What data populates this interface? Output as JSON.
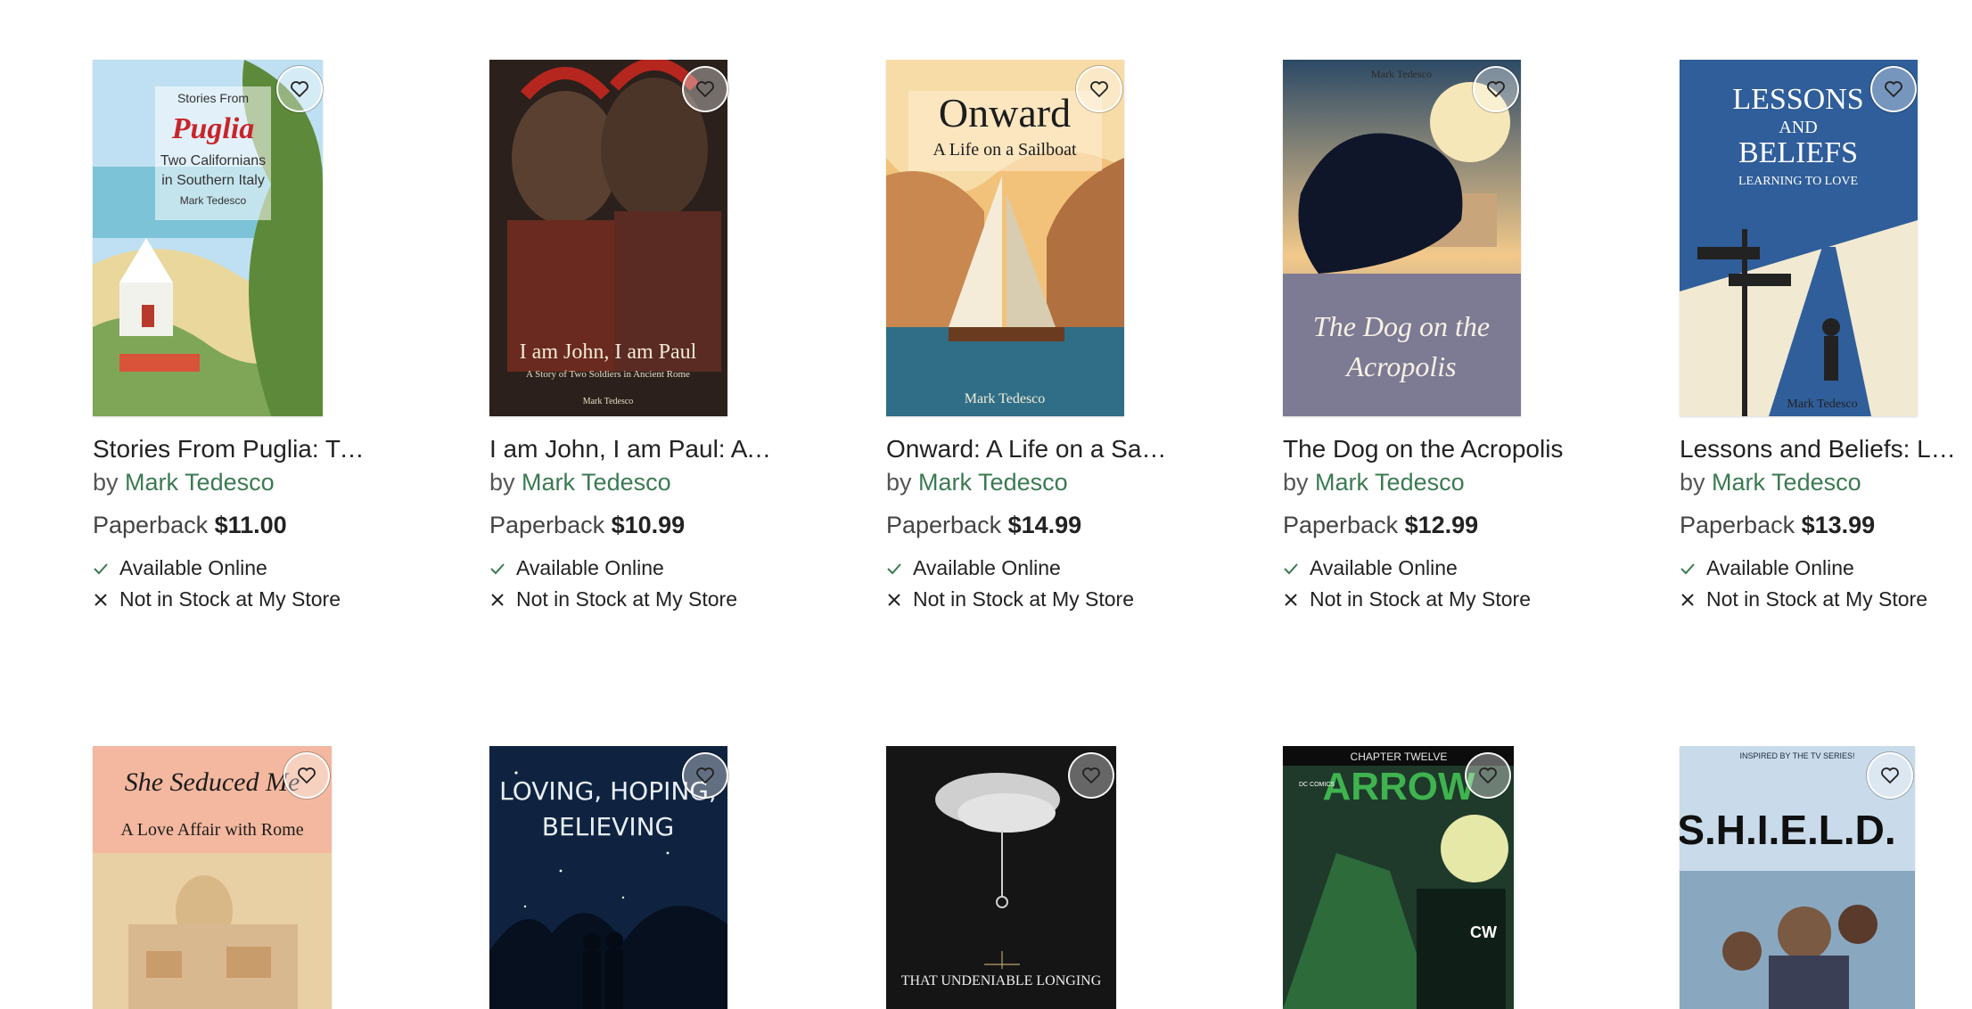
{
  "colors": {
    "author_link": "#3b7a52",
    "check": "#3b7a52",
    "x_mark": "#222222"
  },
  "books": [
    {
      "title": "Stories From Puglia: Two…",
      "by": "by",
      "author": "Mark Tedesco",
      "format": "Paperback",
      "price": "$11.00",
      "online": "Available Online",
      "store": "Not in Stock at My Store",
      "cover": {
        "lines": [
          "Stories From",
          "Puglia",
          "Two Californians",
          "in Southern Italy",
          "Mark Tedesco"
        ]
      }
    },
    {
      "title": "I am John, I am Paul: A St…",
      "by": "by",
      "author": "Mark Tedesco",
      "format": "Paperback",
      "price": "$10.99",
      "online": "Available Online",
      "store": "Not in Stock at My Store",
      "cover": {
        "lines": [
          "I am John, I am Paul",
          "A Story of Two Soldiers in Ancient Rome",
          "Mark Tedesco"
        ]
      }
    },
    {
      "title": "Onward: A Life on a Sailb…",
      "by": "by",
      "author": "Mark Tedesco",
      "format": "Paperback",
      "price": "$14.99",
      "online": "Available Online",
      "store": "Not in Stock at My Store",
      "cover": {
        "lines": [
          "Onward",
          "A Life on a Sailboat",
          "Mark Tedesco"
        ]
      }
    },
    {
      "title": "The Dog on the Acropolis",
      "by": "by",
      "author": "Mark Tedesco",
      "format": "Paperback",
      "price": "$12.99",
      "online": "Available Online",
      "store": "Not in Stock at My Store",
      "cover": {
        "lines": [
          "Mark Tedesco",
          "The Dog on the",
          "Acropolis"
        ]
      }
    },
    {
      "title": "Lessons and Beliefs: Lear…",
      "by": "by",
      "author": "Mark Tedesco",
      "format": "Paperback",
      "price": "$13.99",
      "online": "Available Online",
      "store": "Not in Stock at My Store",
      "cover": {
        "lines": [
          "LESSONS",
          "AND",
          "BELIEFS",
          "LEARNING TO LOVE",
          "Mark Tedesco"
        ]
      }
    },
    {
      "cover": {
        "lines": [
          "She Seduced Me",
          "A Love Affair with Rome"
        ]
      }
    },
    {
      "cover": {
        "lines": [
          "LOVING, HOPING,",
          "BELIEVING"
        ]
      }
    },
    {
      "cover": {
        "lines": [
          "THAT UNDENIABLE LONGING"
        ]
      }
    },
    {
      "cover": {
        "lines": [
          "CHAPTER TWELVE",
          "ARROW",
          "DC COMICS",
          "CW"
        ]
      }
    },
    {
      "cover": {
        "lines": [
          "S.H.I.E.L.D.",
          "INSPIRED BY THE TV SERIES!"
        ]
      }
    }
  ]
}
